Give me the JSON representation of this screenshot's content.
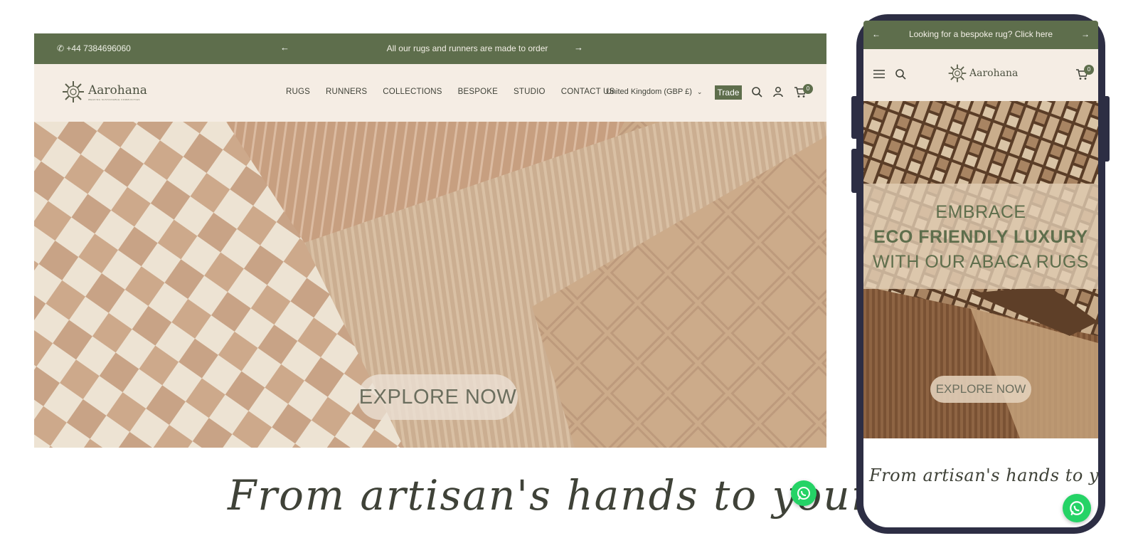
{
  "desktop": {
    "announcement": {
      "phone": "✆ +44 7384696060",
      "message": "All our rugs and runners are made to order",
      "prev_icon": "arrow-left-icon",
      "next_icon": "arrow-right-icon"
    },
    "header": {
      "logo_text": "Aarohana",
      "logo_subtext": "WEAVING SUSTAINABLE COMMUNITIES",
      "nav": [
        "RUGS",
        "RUNNERS",
        "COLLECTIONS",
        "BESPOKE",
        "STUDIO",
        "CONTACT US"
      ],
      "region": "United Kingdom (GBP £)",
      "trade_label": "Trade",
      "cart_count": "0",
      "icons": [
        "search-icon",
        "account-icon",
        "cart-icon"
      ]
    },
    "hero": {
      "cta": "EXPLORE NOW"
    },
    "tagline": "From artisan's hands to your home"
  },
  "mobile": {
    "announcement": {
      "message": "Looking for a bespoke rug? Click here"
    },
    "header": {
      "logo_text": "Aarohana",
      "cart_count": "0",
      "icons": [
        "menu-icon",
        "search-icon",
        "cart-icon"
      ]
    },
    "hero": {
      "line1": "EMBRACE",
      "line2": "ECO FRIENDLY LUXURY",
      "line3": "WITH OUR ABACA RUGS",
      "cta": "EXPLORE NOW"
    },
    "tagline": "From artisan's hands to your home"
  },
  "colors": {
    "brand_green": "#5e6e4c",
    "header_bg": "#f5ede4",
    "whatsapp": "#25d366",
    "phone_frame": "#2d2e44"
  }
}
